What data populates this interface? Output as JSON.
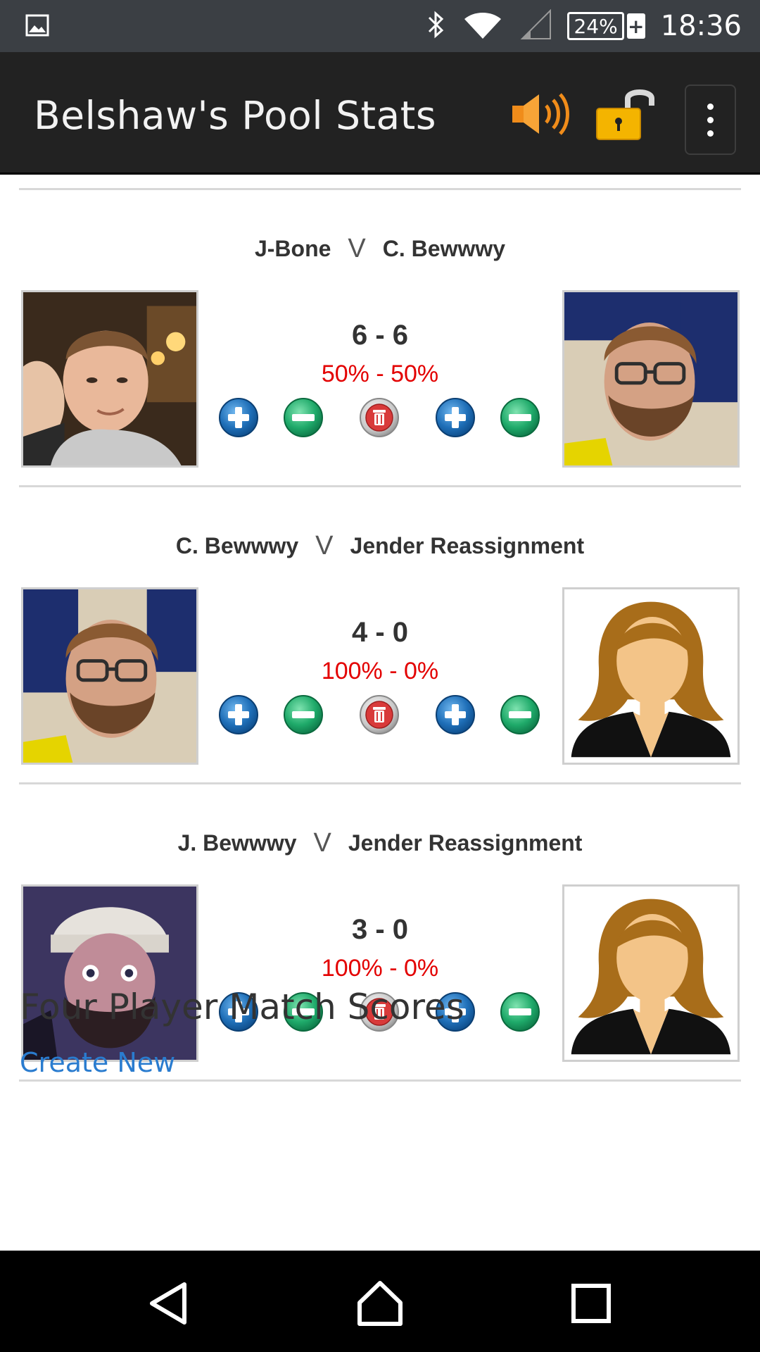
{
  "status_bar": {
    "time": "18:36",
    "battery": "24%",
    "icons": [
      "image-icon",
      "bluetooth-icon",
      "wifi-icon",
      "signal-icon",
      "battery-icon"
    ]
  },
  "app_bar": {
    "title": "Belshaw's Pool Stats",
    "icons": [
      "speaker-icon",
      "unlocked-padlock-icon",
      "overflow-menu-icon"
    ]
  },
  "matches": [
    {
      "player1": "J-Bone",
      "vs": "V",
      "player2": "C. Bewwwy",
      "score": "6 - 6",
      "percent": "50% - 50%"
    },
    {
      "player1": "C. Bewwwy",
      "vs": "V",
      "player2": "Jender Reassignment",
      "score": "4 - 0",
      "percent": "100% - 0%"
    },
    {
      "player1": "J. Bewwwy",
      "vs": "V",
      "player2": "Jender Reassignment",
      "score": "3 - 0",
      "percent": "100% - 0%"
    }
  ],
  "four_player": {
    "title": "Four Player Match Scores",
    "create_link": "Create New"
  },
  "colors": {
    "status_bar": "#3b3f44",
    "app_bar": "#222222",
    "percent_text": "#e30000",
    "plus_button": "#1f6fb8",
    "minus_button": "#1faa6a",
    "delete_button": "#d83a3a",
    "link": "#2a7ccf"
  },
  "nav_bar": {
    "buttons": [
      "back-icon",
      "home-icon",
      "recents-icon"
    ]
  }
}
